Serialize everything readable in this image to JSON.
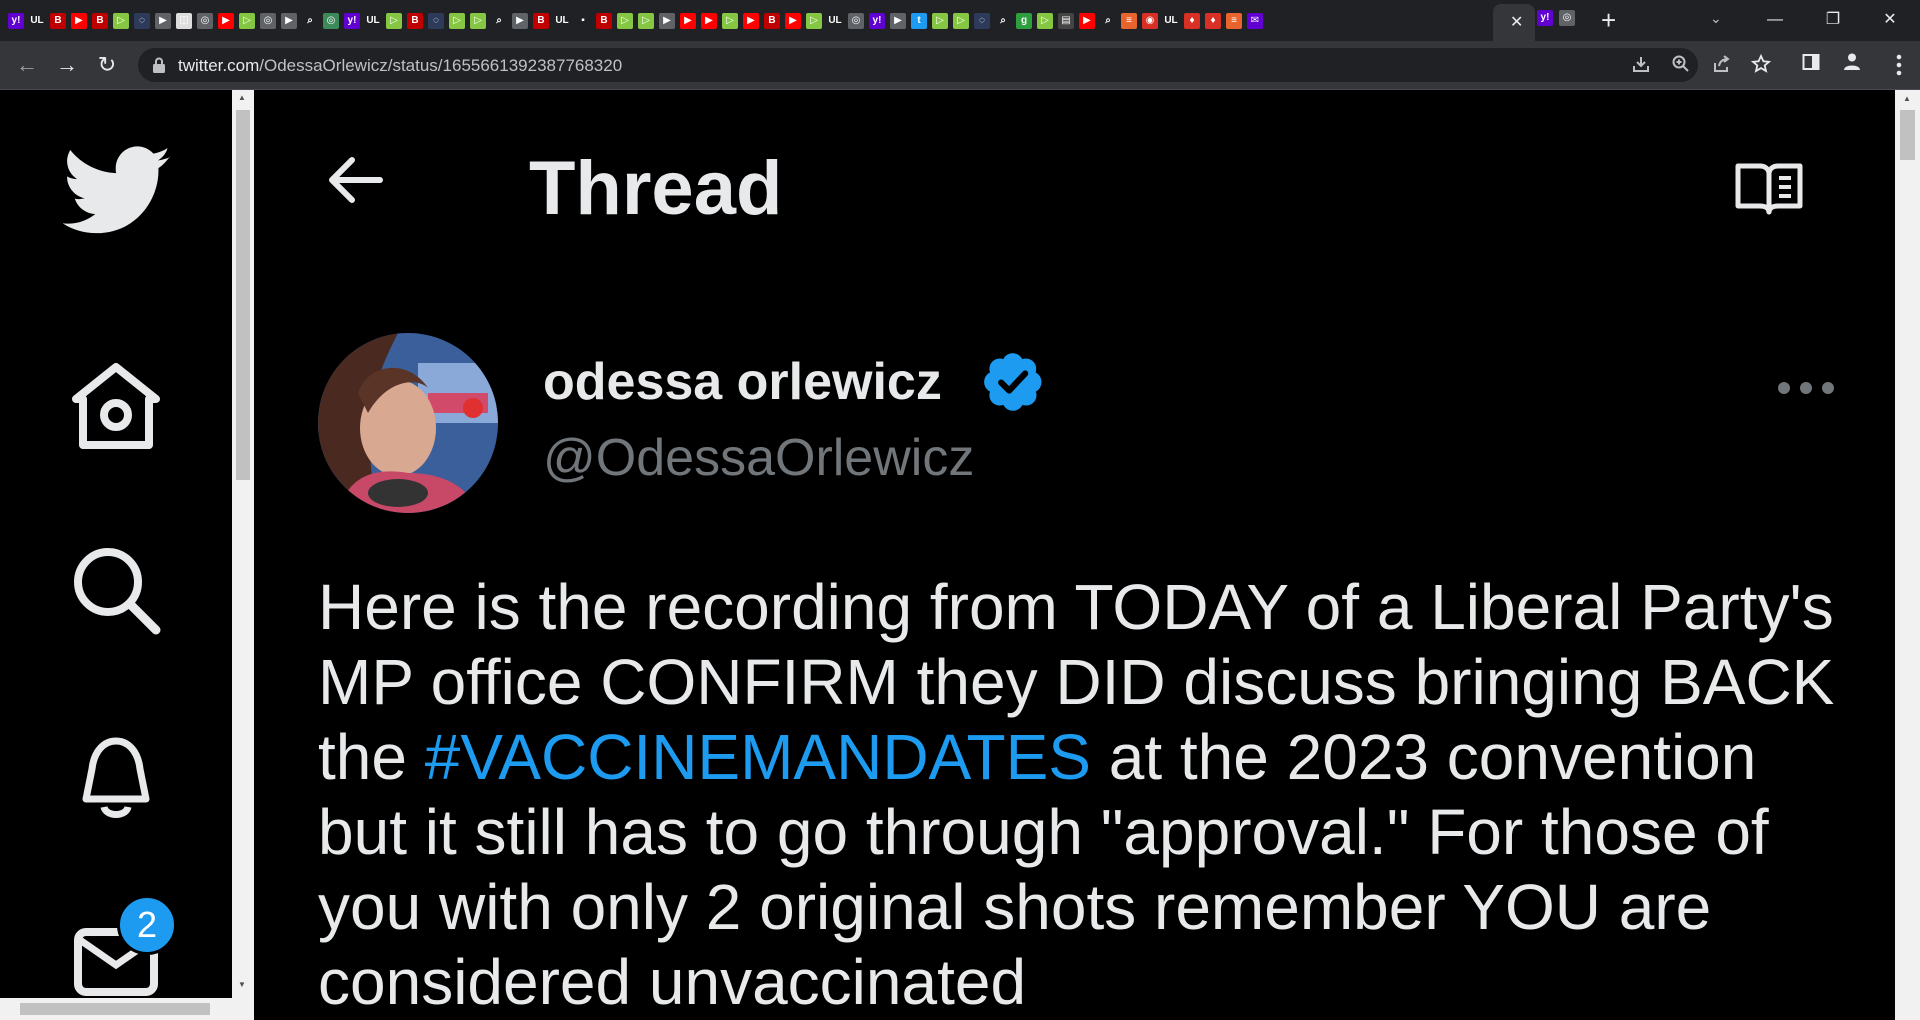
{
  "browser": {
    "tab_close": "✕",
    "new_tab": "+",
    "tab_search": "⌄",
    "window": {
      "minimize": "—",
      "maximize": "❐",
      "close": "✕"
    },
    "nav": {
      "back": "←",
      "forward": "→",
      "reload": "↻"
    },
    "url_host": "twitter.com",
    "url_path": "/OdessaOrlewicz/status/1655661392387768320",
    "tab_favicons": [
      {
        "icon": "yahoo-icon",
        "glyph": "y!",
        "bg": "#6001d2"
      },
      {
        "icon": "ul-icon",
        "glyph": "UL",
        "bg": "#202124"
      },
      {
        "icon": "b-icon",
        "glyph": "B",
        "bg": "#c00000"
      },
      {
        "icon": "youtube-icon",
        "glyph": "▶",
        "bg": "#ff0000"
      },
      {
        "icon": "b-icon",
        "glyph": "B",
        "bg": "#c00000"
      },
      {
        "icon": "rumble-icon",
        "glyph": "▷",
        "bg": "#85c742"
      },
      {
        "icon": "shield-icon",
        "glyph": "◌",
        "bg": "#2d3a5a"
      },
      {
        "icon": "play-icon",
        "glyph": "▶",
        "bg": "#5f6368"
      },
      {
        "icon": "image-icon",
        "glyph": "◫",
        "bg": "#dddddd"
      },
      {
        "icon": "globe-icon",
        "glyph": "◎",
        "bg": "#5f6368"
      },
      {
        "icon": "youtube-icon",
        "glyph": "▶",
        "bg": "#ff0000"
      },
      {
        "icon": "rumble-icon",
        "glyph": "▷",
        "bg": "#85c742"
      },
      {
        "icon": "globe-icon",
        "glyph": "◎",
        "bg": "#5f6368"
      },
      {
        "icon": "play-icon",
        "glyph": "▶",
        "bg": "#5f6368"
      },
      {
        "icon": "search-icon",
        "glyph": "⌕",
        "bg": "#202124"
      },
      {
        "icon": "globe-icon",
        "glyph": "◎",
        "bg": "#3c8a5a"
      },
      {
        "icon": "yahoo-icon",
        "glyph": "y!",
        "bg": "#6001d2"
      },
      {
        "icon": "ul-icon",
        "glyph": "UL",
        "bg": "#202124"
      },
      {
        "icon": "rumble-icon",
        "glyph": "▷",
        "bg": "#85c742"
      },
      {
        "icon": "b-icon",
        "glyph": "B",
        "bg": "#c00000"
      },
      {
        "icon": "shield-icon",
        "glyph": "◌",
        "bg": "#2d3a5a"
      },
      {
        "icon": "rumble-icon",
        "glyph": "▷",
        "bg": "#85c742"
      },
      {
        "icon": "rumble-icon",
        "glyph": "▷",
        "bg": "#85c742"
      },
      {
        "icon": "search-icon",
        "glyph": "⌕",
        "bg": "#202124"
      },
      {
        "icon": "play-icon",
        "glyph": "▶",
        "bg": "#5f6368"
      },
      {
        "icon": "b-icon",
        "glyph": "B",
        "bg": "#c00000"
      },
      {
        "icon": "ul-icon",
        "glyph": "UL",
        "bg": "#202124"
      },
      {
        "icon": "dark-icon",
        "glyph": "▪",
        "bg": "#202124"
      },
      {
        "icon": "b-icon",
        "glyph": "B",
        "bg": "#c00000"
      },
      {
        "icon": "rumble-icon",
        "glyph": "▷",
        "bg": "#85c742"
      },
      {
        "icon": "rumble-icon",
        "glyph": "▷",
        "bg": "#85c742"
      },
      {
        "icon": "play-icon",
        "glyph": "▶",
        "bg": "#5f6368"
      },
      {
        "icon": "youtube-icon",
        "glyph": "▶",
        "bg": "#ff0000"
      },
      {
        "icon": "youtube-icon",
        "glyph": "▶",
        "bg": "#ff0000"
      },
      {
        "icon": "rumble-icon",
        "glyph": "▷",
        "bg": "#85c742"
      },
      {
        "icon": "youtube-icon",
        "glyph": "▶",
        "bg": "#ff0000"
      },
      {
        "icon": "b-icon",
        "glyph": "B",
        "bg": "#c00000"
      },
      {
        "icon": "youtube-icon",
        "glyph": "▶",
        "bg": "#ff0000"
      },
      {
        "icon": "rumble-icon",
        "glyph": "▷",
        "bg": "#85c742"
      },
      {
        "icon": "ul-icon",
        "glyph": "UL",
        "bg": "#202124"
      },
      {
        "icon": "globe-icon",
        "glyph": "◎",
        "bg": "#5f6368"
      },
      {
        "icon": "yahoo-icon",
        "glyph": "y!",
        "bg": "#6001d2"
      },
      {
        "icon": "play-icon",
        "glyph": "▶",
        "bg": "#5f6368"
      },
      {
        "icon": "twitter-icon",
        "glyph": "t",
        "bg": "#1d9bf0"
      },
      {
        "icon": "rumble-icon",
        "glyph": "▷",
        "bg": "#85c742"
      },
      {
        "icon": "rumble-icon",
        "glyph": "▷",
        "bg": "#85c742"
      },
      {
        "icon": "shield-icon",
        "glyph": "◌",
        "bg": "#2d3a5a"
      },
      {
        "icon": "search-icon",
        "glyph": "⌕",
        "bg": "#202124"
      },
      {
        "icon": "g-icon",
        "glyph": "g",
        "bg": "#2e9e3e"
      },
      {
        "icon": "rumble-icon",
        "glyph": "▷",
        "bg": "#85c742"
      },
      {
        "icon": "news-icon",
        "glyph": "▤",
        "bg": "#444444"
      },
      {
        "icon": "youtube-icon",
        "glyph": "▶",
        "bg": "#ff0000"
      },
      {
        "icon": "search-icon",
        "glyph": "⌕",
        "bg": "#202124"
      },
      {
        "icon": "bookmark-icon",
        "glyph": "≡",
        "bg": "#e8642c"
      },
      {
        "icon": "shield-red-icon",
        "glyph": "◉",
        "bg": "#d93025"
      },
      {
        "icon": "ul-icon",
        "glyph": "UL",
        "bg": "#202124"
      },
      {
        "icon": "maple-icon",
        "glyph": "♦",
        "bg": "#d93025"
      },
      {
        "icon": "maple-icon",
        "glyph": "♦",
        "bg": "#d93025"
      },
      {
        "icon": "bookmark-icon",
        "glyph": "≡",
        "bg": "#e8642c"
      },
      {
        "icon": "yahoo-mail-icon",
        "glyph": "✉",
        "bg": "#6001d2"
      }
    ],
    "tabs_after_active": [
      {
        "icon": "yahoo-icon",
        "glyph": "y!",
        "bg": "#6001d2"
      },
      {
        "icon": "globe-icon",
        "glyph": "◎",
        "bg": "#5f6368"
      }
    ],
    "accent": "#1d9bf0"
  },
  "header": {
    "title": "Thread"
  },
  "tweet": {
    "display_name": "odessa orlewicz",
    "handle": "@OdessaOrlewicz",
    "text_before": "Here is the recording from TODAY of a Liberal Party's MP office CONFIRM they DID discuss bringing BACK the ",
    "hashtag": "#VACCINEMANDATES",
    "text_after": " at the 2023 convention but it still has to go through \"approval.\" For those of you with only 2 original shots remember YOU are considered unvaccinated"
  },
  "sidebar": {
    "messages_badge": "2"
  }
}
